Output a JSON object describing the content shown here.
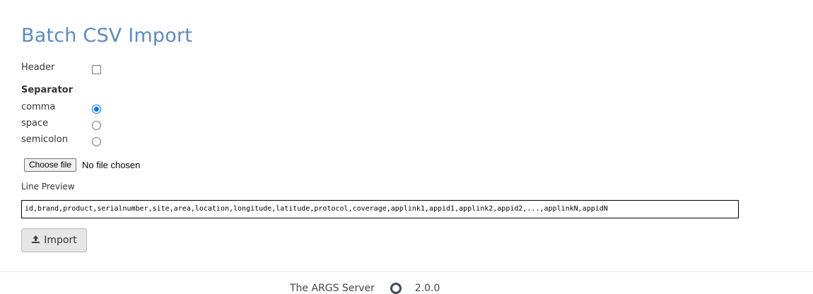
{
  "page": {
    "title": "Batch CSV Import"
  },
  "header_option": {
    "label": "Header",
    "checked": false
  },
  "separator": {
    "label": "Separator",
    "options": [
      {
        "label": "comma",
        "checked": true
      },
      {
        "label": "space",
        "checked": false
      },
      {
        "label": "semicolon",
        "checked": false
      }
    ]
  },
  "file": {
    "button_label": "Choose file",
    "status": "No file chosen"
  },
  "preview": {
    "label": "Line Preview",
    "value": "id,brand,product,serialnumber,site,area,location,longitude,latitude,protocol,coverage,applink1,appid1,applink2,appid2,...,applinkN,appidN"
  },
  "import_button": {
    "label": "Import",
    "icon": "upload-icon"
  },
  "footer": {
    "text_left": "The ARGS Server",
    "text_right": "2.0.0"
  }
}
